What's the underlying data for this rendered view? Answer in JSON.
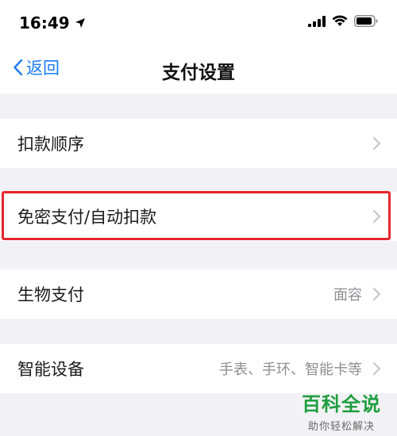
{
  "status_bar": {
    "time": "16:49",
    "icons": [
      "location-arrow-icon",
      "cellular-signal-icon",
      "wifi-icon",
      "battery-icon"
    ]
  },
  "nav": {
    "back_label": "返回",
    "title": "支付设置",
    "accent_color": "#1a7cf2"
  },
  "rows": [
    {
      "label": "扣款顺序",
      "value": ""
    },
    {
      "label": "免密支付/自动扣款",
      "value": ""
    },
    {
      "label": "生物支付",
      "value": "面容"
    },
    {
      "label": "智能设备",
      "value": "手表、手环、智能卡等"
    }
  ],
  "highlight": {
    "row": 1,
    "color": "#e5262b"
  },
  "watermark": {
    "title": "百科全说",
    "subtitle": "助你轻松解决"
  }
}
